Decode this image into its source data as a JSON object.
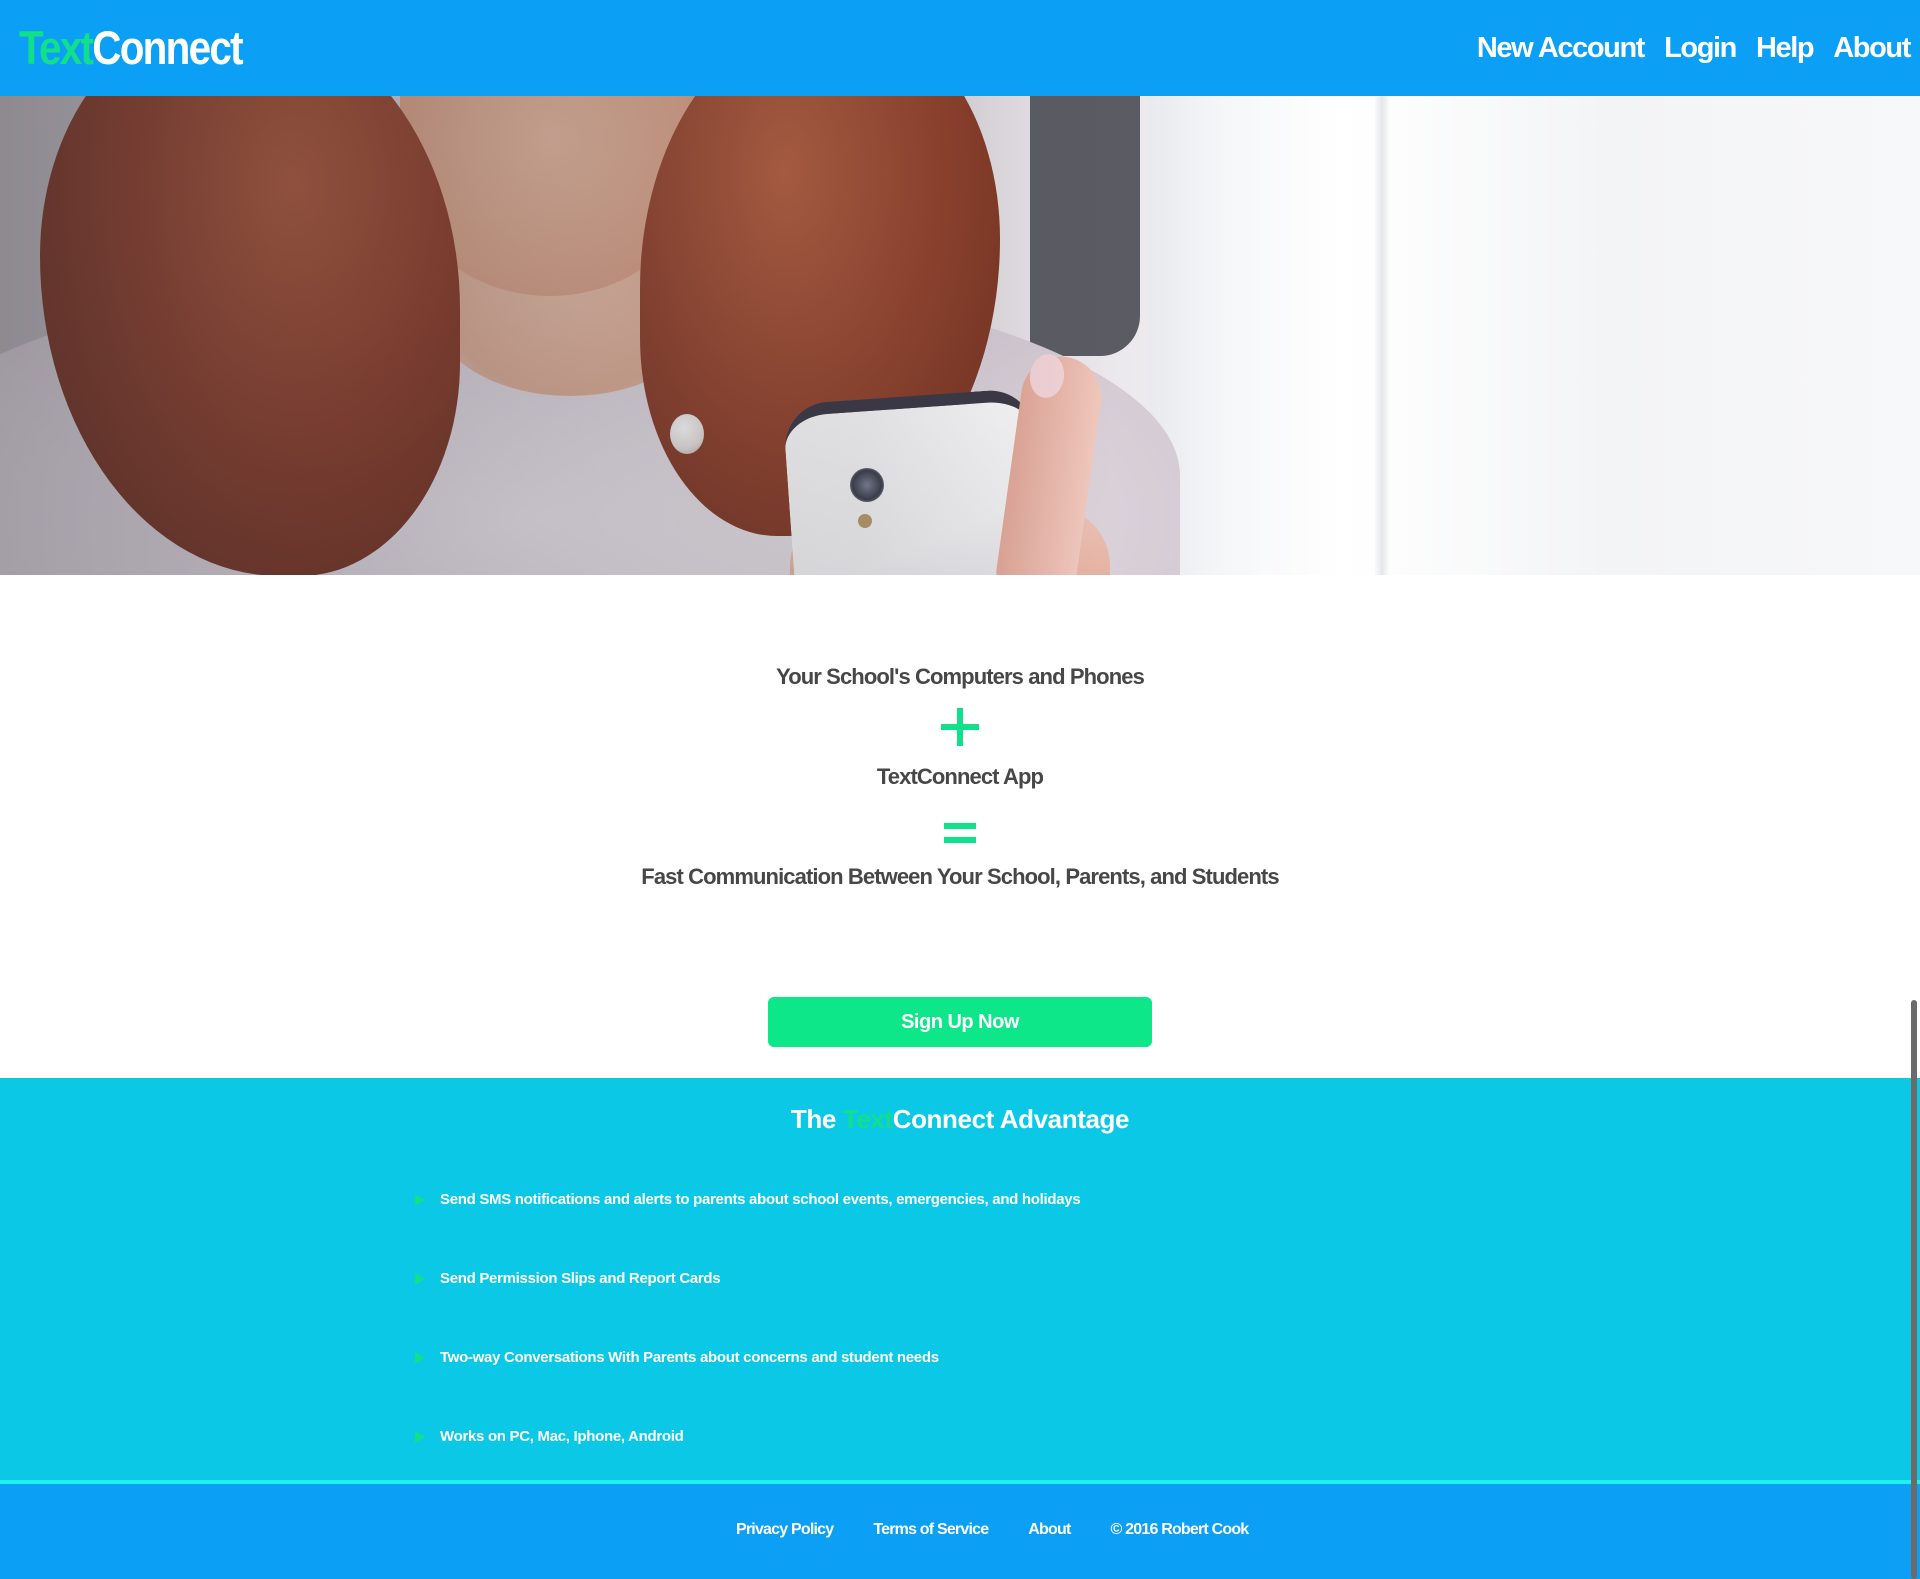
{
  "header": {
    "logo_accent": "Text",
    "logo_rest": "Connect",
    "nav": [
      "New Account",
      "Login",
      "Help",
      "About"
    ]
  },
  "hero": {
    "image": "woman-holding-phone-photo"
  },
  "equation": {
    "line1": "Your School's Computers and Phones",
    "line2": "TextConnect App",
    "line3": "Fast Communication Between Your School, Parents, and Students",
    "plus_symbol": "plus-icon",
    "equals_symbol": "equals-icon"
  },
  "cta": {
    "label": "Sign Up Now"
  },
  "advantage": {
    "title_prefix": "The ",
    "title_accent": "Text",
    "title_suffix": "Connect Advantage",
    "items": [
      "Send SMS notifications and alerts to parents about school events, emergencies, and holidays",
      "Send Permission Slips and Report Cards",
      "Two-way Conversations With Parents about concerns and student needs",
      "Works on PC, Mac, Iphone, Android"
    ]
  },
  "footer": {
    "links": [
      "Privacy Policy",
      "Terms of Service",
      "About"
    ],
    "copyright": "© 2016 Robert Cook"
  },
  "colors": {
    "header_blue": "#0b9ff5",
    "accent_green": "#11e08a",
    "advantage_cyan": "#0bc8e6",
    "divider_cyan": "#1ff0f0",
    "text_dark": "#474747"
  }
}
